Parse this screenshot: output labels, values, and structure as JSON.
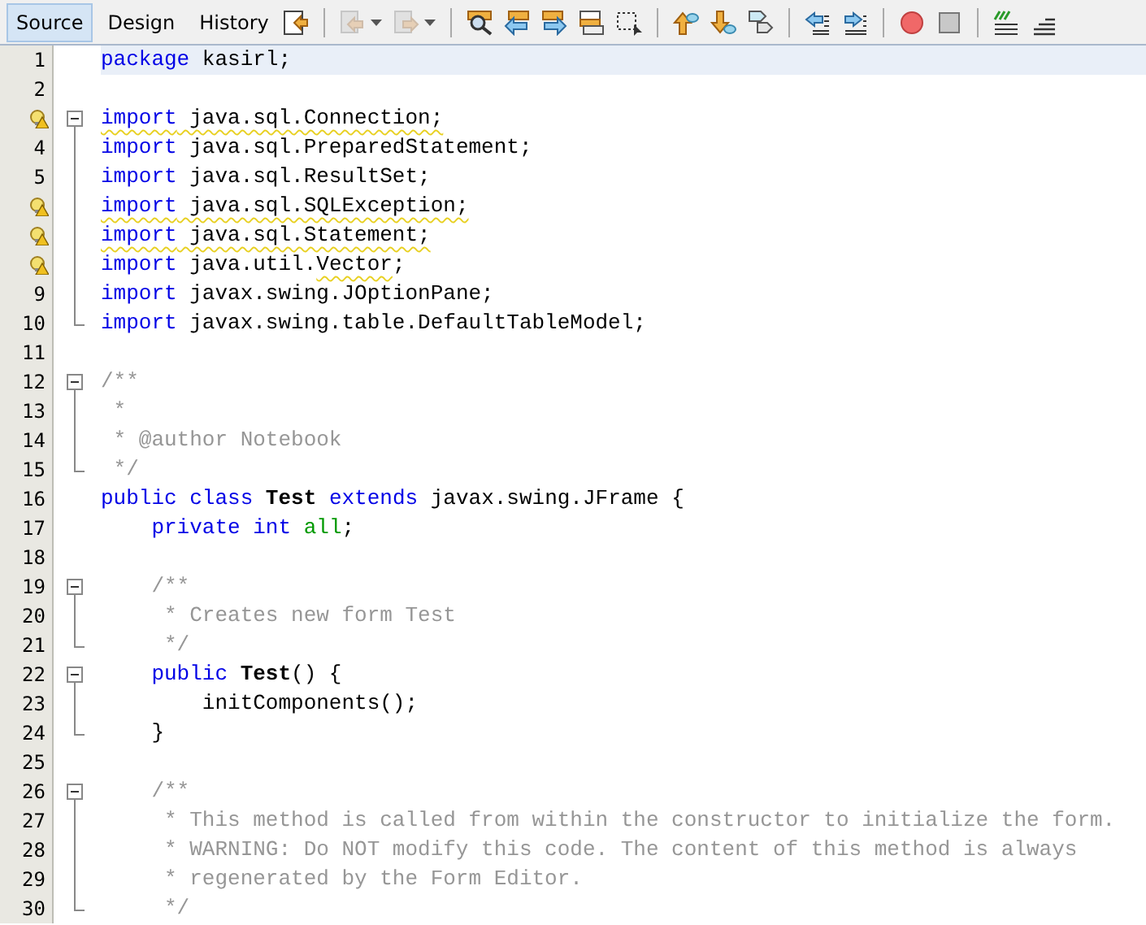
{
  "tabs": [
    {
      "label": "Source",
      "selected": true
    },
    {
      "label": "Design",
      "selected": false
    },
    {
      "label": "History",
      "selected": false
    }
  ],
  "toolbar": [
    {
      "kind": "last-edit",
      "disabled": false
    },
    {
      "kind": "separator"
    },
    {
      "kind": "back",
      "disabled": true
    },
    {
      "kind": "caret",
      "disabled": false
    },
    {
      "kind": "forward",
      "disabled": true
    },
    {
      "kind": "caret",
      "disabled": false
    },
    {
      "kind": "separator"
    },
    {
      "kind": "find",
      "disabled": false
    },
    {
      "kind": "find-prev",
      "disabled": false
    },
    {
      "kind": "find-next",
      "disabled": false
    },
    {
      "kind": "highlight",
      "disabled": false
    },
    {
      "kind": "select-rect",
      "disabled": false
    },
    {
      "kind": "separator"
    },
    {
      "kind": "bookmark-prev",
      "disabled": false
    },
    {
      "kind": "bookmark-next",
      "disabled": false
    },
    {
      "kind": "bookmark-toggle",
      "disabled": false
    },
    {
      "kind": "separator"
    },
    {
      "kind": "shift-left",
      "disabled": false
    },
    {
      "kind": "shift-right",
      "disabled": false
    },
    {
      "kind": "separator"
    },
    {
      "kind": "record",
      "disabled": false
    },
    {
      "kind": "stop",
      "disabled": false
    },
    {
      "kind": "separator"
    },
    {
      "kind": "comment",
      "disabled": false
    },
    {
      "kind": "uncomment",
      "disabled": false
    }
  ],
  "lines": [
    {
      "number": "1",
      "current": true,
      "tokens": [
        {
          "text": "package",
          "kind": "kw"
        },
        {
          "text": " kasirl;",
          "kind": "plain"
        }
      ]
    },
    {
      "number": "2",
      "current": false
    },
    {
      "current": false,
      "warning": true,
      "fold": {
        "kind": "toggle",
        "expanded": true
      },
      "tokens": [
        {
          "text": "import",
          "kind": "kw",
          "underline": true
        },
        {
          "text": " java.sql.Connection;",
          "kind": "plain",
          "underline": true
        }
      ]
    },
    {
      "number": "4",
      "current": false,
      "fold": {
        "kind": "line"
      },
      "tokens": [
        {
          "text": "import",
          "kind": "kw"
        },
        {
          "text": " java.sql.PreparedStatement;",
          "kind": "plain"
        }
      ]
    },
    {
      "number": "5",
      "current": false,
      "fold": {
        "kind": "line"
      },
      "tokens": [
        {
          "text": "import",
          "kind": "kw"
        },
        {
          "text": " java.sql.ResultSet;",
          "kind": "plain"
        }
      ]
    },
    {
      "current": false,
      "warning": true,
      "fold": {
        "kind": "line"
      },
      "tokens": [
        {
          "text": "import",
          "kind": "kw",
          "underline": true
        },
        {
          "text": " java.sql.SQLException;",
          "kind": "plain",
          "underline": true
        }
      ]
    },
    {
      "current": false,
      "warning": true,
      "fold": {
        "kind": "line"
      },
      "tokens": [
        {
          "text": "import",
          "kind": "kw",
          "underline": true
        },
        {
          "text": " java.sql.Statement;",
          "kind": "plain",
          "underline": true
        }
      ]
    },
    {
      "current": false,
      "warning": true,
      "fold": {
        "kind": "line"
      },
      "tokens": [
        {
          "text": "import",
          "kind": "kw"
        },
        {
          "text": " java.util.",
          "kind": "plain"
        },
        {
          "text": "Vector",
          "kind": "plain",
          "underline": true
        },
        {
          "text": ";",
          "kind": "plain"
        }
      ]
    },
    {
      "number": "9",
      "current": false,
      "fold": {
        "kind": "line"
      },
      "tokens": [
        {
          "text": "import",
          "kind": "kw"
        },
        {
          "text": " javax.swing.JOptionPane;",
          "kind": "plain"
        }
      ]
    },
    {
      "number": "10",
      "current": false,
      "fold": {
        "kind": "end"
      },
      "tokens": [
        {
          "text": "import",
          "kind": "kw"
        },
        {
          "text": " javax.swing.table.DefaultTableModel;",
          "kind": "plain"
        }
      ]
    },
    {
      "number": "11",
      "current": false
    },
    {
      "number": "12",
      "current": false,
      "fold": {
        "kind": "toggle",
        "expanded": true
      },
      "tokens": [
        {
          "text": "/**",
          "kind": "comment"
        }
      ]
    },
    {
      "number": "13",
      "current": false,
      "fold": {
        "kind": "line"
      },
      "tokens": [
        {
          "text": " *",
          "kind": "comment"
        }
      ]
    },
    {
      "number": "14",
      "current": false,
      "fold": {
        "kind": "line"
      },
      "tokens": [
        {
          "text": " * @author Notebook",
          "kind": "comment"
        }
      ]
    },
    {
      "number": "15",
      "current": false,
      "fold": {
        "kind": "end"
      },
      "tokens": [
        {
          "text": " */",
          "kind": "comment"
        }
      ]
    },
    {
      "number": "16",
      "current": false,
      "tokens": [
        {
          "text": "public",
          "kind": "kw"
        },
        {
          "text": " class",
          "kind": "kw"
        },
        {
          "text": " Test",
          "kind": "name"
        },
        {
          "text": " extends",
          "kind": "kw"
        },
        {
          "text": " javax.swing.JFrame {",
          "kind": "plain"
        }
      ]
    },
    {
      "number": "17",
      "current": false,
      "tokens": [
        {
          "text": "    private",
          "kind": "kw"
        },
        {
          "text": " int",
          "kind": "kw"
        },
        {
          "text": " all",
          "kind": "field"
        },
        {
          "text": ";",
          "kind": "plain"
        }
      ]
    },
    {
      "number": "18",
      "current": false
    },
    {
      "number": "19",
      "current": false,
      "fold": {
        "kind": "toggle",
        "expanded": true
      },
      "tokens": [
        {
          "text": "    /**",
          "kind": "comment"
        }
      ]
    },
    {
      "number": "20",
      "current": false,
      "fold": {
        "kind": "line"
      },
      "tokens": [
        {
          "text": "     * Creates new form Test",
          "kind": "comment"
        }
      ]
    },
    {
      "number": "21",
      "current": false,
      "fold": {
        "kind": "end"
      },
      "tokens": [
        {
          "text": "     */",
          "kind": "comment"
        }
      ]
    },
    {
      "number": "22",
      "current": false,
      "fold": {
        "kind": "toggle",
        "expanded": true
      },
      "tokens": [
        {
          "text": "    public",
          "kind": "kw"
        },
        {
          "text": " Test",
          "kind": "name"
        },
        {
          "text": "() {",
          "kind": "plain"
        }
      ]
    },
    {
      "number": "23",
      "current": false,
      "fold": {
        "kind": "line"
      },
      "tokens": [
        {
          "text": "        initComponents();",
          "kind": "plain"
        }
      ]
    },
    {
      "number": "24",
      "current": false,
      "fold": {
        "kind": "end"
      },
      "tokens": [
        {
          "text": "    }",
          "kind": "plain"
        }
      ]
    },
    {
      "number": "25",
      "current": false
    },
    {
      "number": "26",
      "current": false,
      "fold": {
        "kind": "toggle",
        "expanded": true
      },
      "tokens": [
        {
          "text": "    /**",
          "kind": "comment"
        }
      ]
    },
    {
      "number": "27",
      "current": false,
      "fold": {
        "kind": "line"
      },
      "tokens": [
        {
          "text": "     * This method is called from within the constructor to initialize the form.",
          "kind": "comment"
        }
      ]
    },
    {
      "number": "28",
      "current": false,
      "fold": {
        "kind": "line"
      },
      "tokens": [
        {
          "text": "     * WARNING: Do NOT modify this code. The content of this method is always",
          "kind": "comment"
        }
      ]
    },
    {
      "number": "29",
      "current": false,
      "fold": {
        "kind": "line"
      },
      "tokens": [
        {
          "text": "     * regenerated by the Form Editor.",
          "kind": "comment"
        }
      ]
    },
    {
      "number": "30",
      "current": false,
      "fold": {
        "kind": "end"
      },
      "tokens": [
        {
          "text": "     */",
          "kind": "comment"
        }
      ]
    }
  ]
}
